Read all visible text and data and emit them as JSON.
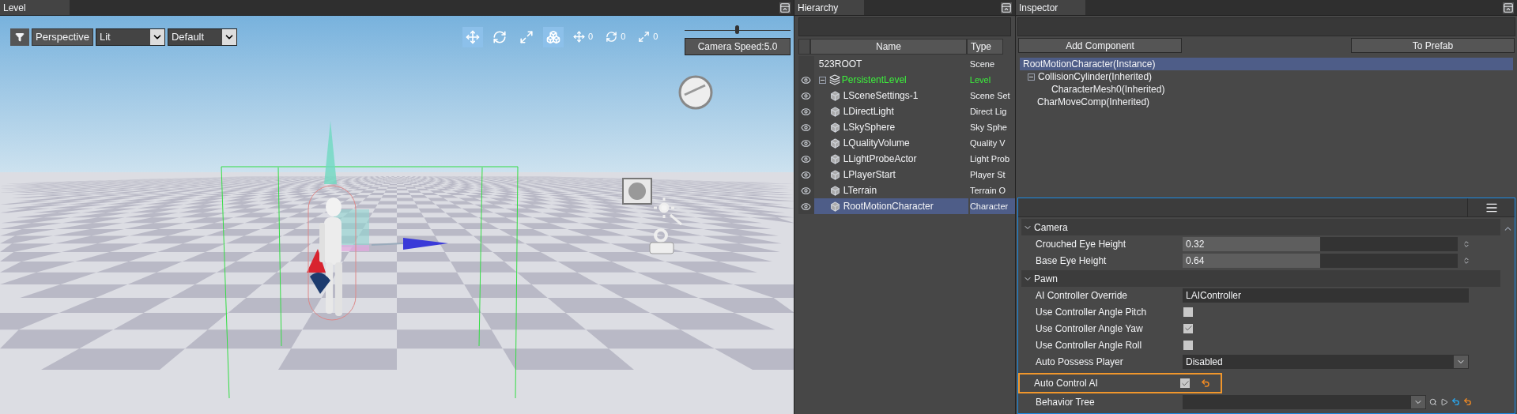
{
  "viewport": {
    "tab": "Level",
    "view_mode": "Perspective",
    "lighting": "Lit",
    "preset": "Default",
    "tools": [
      {
        "kind": "move",
        "selected": true
      },
      {
        "kind": "rotate",
        "selected": false
      },
      {
        "kind": "scale",
        "selected": false
      },
      {
        "kind": "local",
        "selected": true
      }
    ],
    "snaps": [
      {
        "kind": "move",
        "value": "0"
      },
      {
        "kind": "rotate",
        "value": "0"
      },
      {
        "kind": "scale",
        "value": "0"
      }
    ],
    "camera_speed": {
      "label": "Camera Speed:5.0",
      "level": 0.49
    }
  },
  "hierarchy": {
    "tab": "Hierarchy",
    "columns": [
      "Name",
      "Type"
    ],
    "rows": [
      {
        "kind": "scene",
        "name": "523ROOT",
        "type": "Scene",
        "selected": false,
        "children": [
          {
            "kind": "level",
            "name": "PersistentLevel",
            "type": "Level",
            "selected": false,
            "visible": true,
            "expanded": true,
            "children": [
              {
                "kind": "actor",
                "name": "LSceneSettings-1",
                "type": "Scene Set",
                "selected": false,
                "visible": true
              },
              {
                "kind": "actor",
                "name": "LDirectLight",
                "type": "Direct Lig",
                "selected": false,
                "visible": true
              },
              {
                "kind": "actor",
                "name": "LSkySphere",
                "type": "Sky Sphe",
                "selected": false,
                "visible": true
              },
              {
                "kind": "actor",
                "name": "LQualityVolume",
                "type": "Quality V",
                "selected": false,
                "visible": true
              },
              {
                "kind": "actor",
                "name": "LLightProbeActor",
                "type": "Light Prob",
                "selected": false,
                "visible": true
              },
              {
                "kind": "actor",
                "name": "LPlayerStart",
                "type": "Player St",
                "selected": false,
                "visible": true
              },
              {
                "kind": "actor",
                "name": "LTerrain",
                "type": "Terrain O",
                "selected": false,
                "visible": true
              },
              {
                "kind": "actor",
                "name": "RootMotionCharacter",
                "type": "Character",
                "selected": true,
                "visible": true
              }
            ]
          }
        ]
      }
    ]
  },
  "inspector": {
    "tab": "Inspector",
    "buttons": [
      "Add Component",
      "To Prefab"
    ],
    "components": [
      {
        "name": "RootMotionCharacter(Instance)",
        "selected": true,
        "children": [
          {
            "name": "CollisionCylinder(Inherited)",
            "selected": false,
            "expanded": true,
            "children": [
              {
                "name": "CharacterMesh0(Inherited)",
                "selected": false
              }
            ]
          },
          {
            "name": "CharMoveComp(Inherited)",
            "selected": false
          }
        ]
      }
    ],
    "properties": [
      {
        "kind": "section",
        "label": "Camera",
        "expanded": true
      },
      {
        "kind": "number",
        "label": "Crouched Eye Height",
        "value": "0.32",
        "level": 0.5
      },
      {
        "kind": "number",
        "label": "Base Eye Height",
        "value": "0.64",
        "level": 0.5
      },
      {
        "kind": "section",
        "label": "Pawn",
        "expanded": true
      },
      {
        "kind": "text",
        "label": "AI Controller Override",
        "value": "LAIController"
      },
      {
        "kind": "checkbox",
        "label": "Use Controller Angle Pitch",
        "checked": false
      },
      {
        "kind": "checkbox",
        "label": "Use Controller Angle Yaw",
        "checked": true
      },
      {
        "kind": "checkbox",
        "label": "Use Controller Angle Roll",
        "checked": false
      },
      {
        "kind": "dropdown",
        "label": "Auto Possess Player",
        "value": "Disabled"
      },
      {
        "kind": "checkbox",
        "label": "Auto Control AI",
        "checked": true,
        "highlighted": true,
        "modified": true
      },
      {
        "kind": "asset",
        "label": "Behavior Tree"
      }
    ]
  }
}
